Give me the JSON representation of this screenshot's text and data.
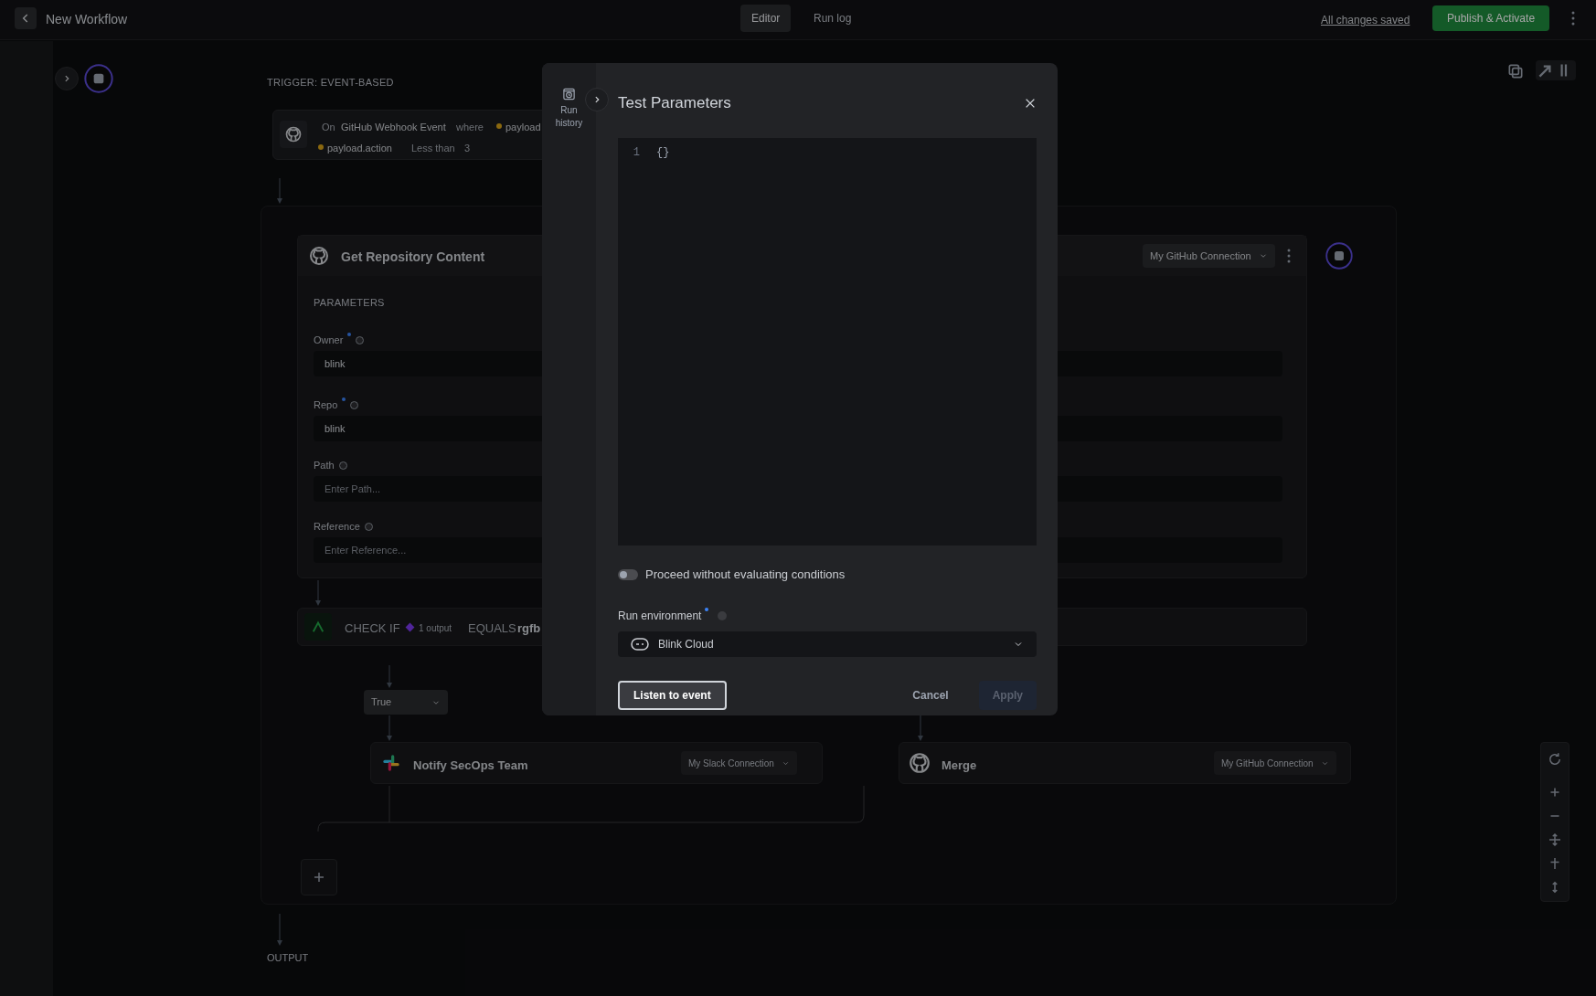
{
  "header": {
    "title": "New Workflow",
    "tabs": [
      {
        "label": "Editor",
        "selected": true
      },
      {
        "label": "Run log",
        "selected": false
      }
    ],
    "save_status": "All changes saved",
    "publish_button": "Publish & Activate"
  },
  "canvas": {
    "trigger_label": "TRIGGER: EVENT-BASED",
    "trigger": {
      "prefix": "On",
      "event": "GitHub Webhook Event",
      "keyword": "where",
      "tokens": [
        "payload",
        "payload.action",
        "Less than",
        "3"
      ]
    },
    "step": {
      "title": "Get Repository Content",
      "connection": "My GitHub Connection",
      "section": "PARAMETERS",
      "fields": [
        {
          "label": "Owner",
          "required": true,
          "value": "blink"
        },
        {
          "label": "Repo",
          "required": true,
          "value": "blink"
        },
        {
          "label": "Path",
          "required": false,
          "placeholder": "Enter Path..."
        },
        {
          "label": "Reference",
          "required": false,
          "placeholder": "Enter Reference..."
        }
      ]
    },
    "condition": {
      "label": "CHECK IF",
      "output": "1 output",
      "operator": "EQUALS",
      "value": "rgfb"
    },
    "branch": "True",
    "actions": [
      {
        "title": "Notify SecOps Team",
        "connection": "My Slack Connection",
        "kind": "slack"
      },
      {
        "title": "Merge",
        "connection": "My GitHub Connection",
        "kind": "github"
      }
    ],
    "output_label": "OUTPUT"
  },
  "dialog": {
    "rail_label": "Run history",
    "title": "Test Parameters",
    "editor_lines": [
      {
        "number": "1",
        "code": "{}"
      }
    ],
    "toggle": {
      "label": "Proceed without evaluating conditions",
      "on": false
    },
    "run_environment": {
      "label": "Run environment",
      "required": true,
      "value": "Blink Cloud"
    },
    "buttons": [
      {
        "label": "Listen to event",
        "kind": "outline"
      },
      {
        "label": "Cancel",
        "kind": "text"
      },
      {
        "label": "Apply",
        "kind": "primary",
        "disabled": true
      }
    ]
  }
}
